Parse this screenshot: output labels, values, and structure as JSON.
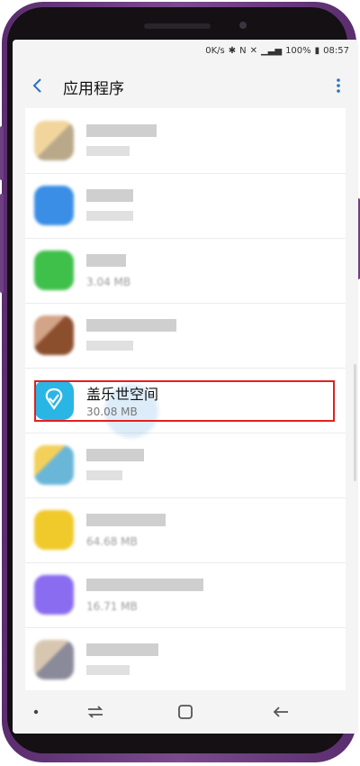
{
  "status": {
    "net_speed": "0K/s",
    "battery": "100%",
    "time": "08:57"
  },
  "appbar": {
    "title": "应用程序"
  },
  "apps": [
    {
      "name": "",
      "size": "",
      "blurred": true,
      "icon_color": "#f1d59c"
    },
    {
      "name": "",
      "size": "",
      "blurred": true,
      "icon_color": "#3a8ee6"
    },
    {
      "name": "",
      "size": "3.04 MB",
      "blurred": true,
      "icon_color": "#3fc04b"
    },
    {
      "name": "",
      "size": "",
      "blurred": true,
      "icon_color": "#8c4f2d"
    },
    {
      "name": "盖乐世空间",
      "size": "30.08 MB",
      "blurred": false,
      "icon_color": "#2ab6e5"
    },
    {
      "name": "",
      "size": "",
      "blurred": true,
      "icon_color": "#6ab6d9"
    },
    {
      "name": "",
      "size": "64.68 MB",
      "blurred": true,
      "icon_color": "#f0c92a"
    },
    {
      "name": "",
      "size": "16.71 MB",
      "blurred": true,
      "icon_color": "#8a6cf0"
    },
    {
      "name": "",
      "size": "",
      "blurred": true,
      "icon_color": "#b7b7b7"
    }
  ],
  "colors": {
    "highlight": "#e41f1f",
    "accent": "#2ab6e5"
  }
}
